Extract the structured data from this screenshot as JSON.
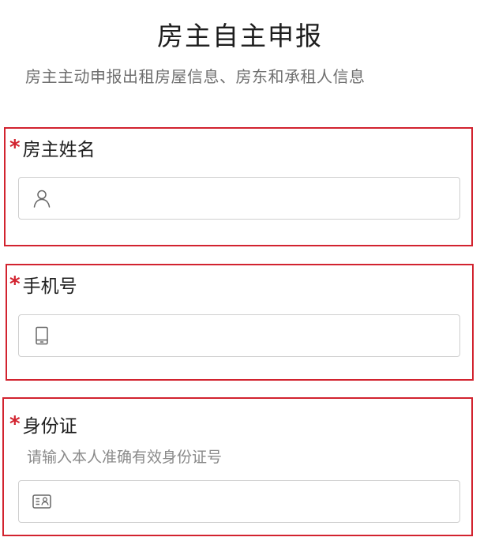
{
  "header": {
    "title": "房主自主申报",
    "subtitle": "房主主动申报出租房屋信息、房东和承租人信息"
  },
  "fields": {
    "owner_name": {
      "required_mark": "*",
      "label": "房主姓名",
      "icon": "user-icon",
      "value": "",
      "placeholder": ""
    },
    "phone": {
      "required_mark": "*",
      "label": "手机号",
      "icon": "mobile-phone-icon",
      "value": "",
      "placeholder": ""
    },
    "id_card": {
      "required_mark": "*",
      "label": "身份证",
      "hint": "请输入本人准确有效身份证号",
      "icon": "id-card-icon",
      "value": "",
      "placeholder": ""
    }
  },
  "colors": {
    "required": "#d2232f",
    "highlight_border": "#d2232f",
    "input_border": "#cfcfcf",
    "hint_text": "#8a8a8a"
  }
}
